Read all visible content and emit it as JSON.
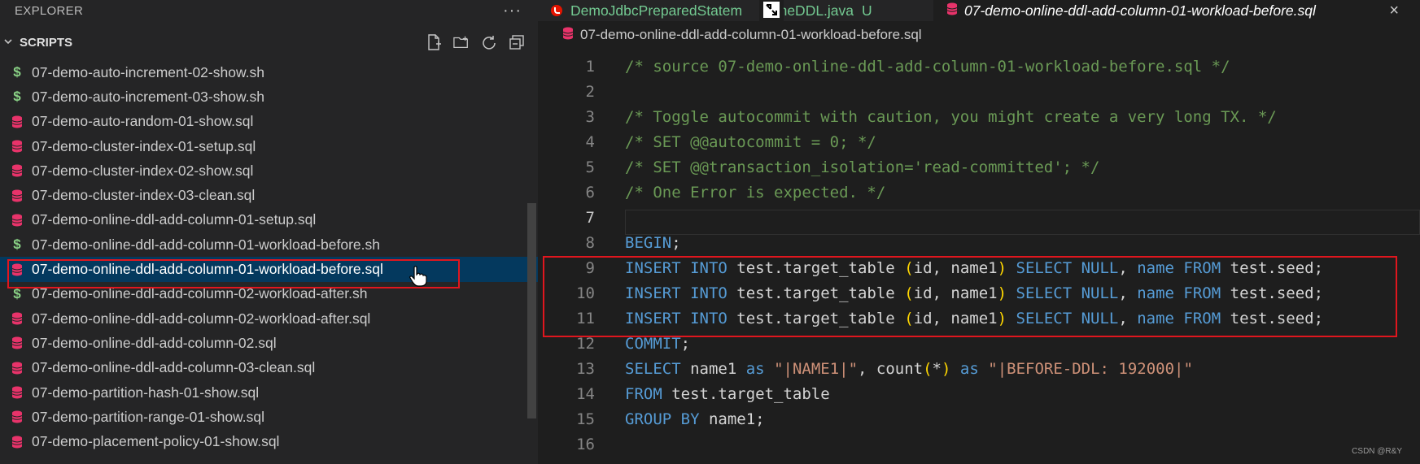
{
  "sidebar": {
    "title": "EXPLORER",
    "more_label": "···",
    "section_title": "SCRIPTS",
    "files": [
      {
        "name": "07-demo-auto-increment-02-show.sh",
        "type": "sh"
      },
      {
        "name": "07-demo-auto-increment-03-show.sh",
        "type": "sh"
      },
      {
        "name": "07-demo-auto-random-01-show.sql",
        "type": "sql"
      },
      {
        "name": "07-demo-cluster-index-01-setup.sql",
        "type": "sql"
      },
      {
        "name": "07-demo-cluster-index-02-show.sql",
        "type": "sql"
      },
      {
        "name": "07-demo-cluster-index-03-clean.sql",
        "type": "sql"
      },
      {
        "name": "07-demo-online-ddl-add-column-01-setup.sql",
        "type": "sql"
      },
      {
        "name": "07-demo-online-ddl-add-column-01-workload-before.sh",
        "type": "sh"
      },
      {
        "name": "07-demo-online-ddl-add-column-01-workload-before.sql",
        "type": "sql",
        "selected": true
      },
      {
        "name": "07-demo-online-ddl-add-column-02-workload-after.sh",
        "type": "sh"
      },
      {
        "name": "07-demo-online-ddl-add-column-02-workload-after.sql",
        "type": "sql"
      },
      {
        "name": "07-demo-online-ddl-add-column-02.sql",
        "type": "sql"
      },
      {
        "name": "07-demo-online-ddl-add-column-03-clean.sql",
        "type": "sql"
      },
      {
        "name": "07-demo-partition-hash-01-show.sql",
        "type": "sql"
      },
      {
        "name": "07-demo-partition-range-01-show.sql",
        "type": "sql"
      },
      {
        "name": "07-demo-placement-policy-01-show.sql",
        "type": "sql"
      }
    ]
  },
  "tabs": {
    "tab1_left": "DemoJdbcPreparedStatem",
    "tab1_right": "nlineDDL.java",
    "tab1_status": "U",
    "tab2_label": "07-demo-online-ddl-add-column-01-workload-before.sql",
    "tab2_close": "×"
  },
  "breadcrumb": "07-demo-online-ddl-add-column-01-workload-before.sql",
  "editor": {
    "active_line": 7,
    "lines": [
      {
        "n": "1",
        "tokens": [
          [
            "cm",
            "/* source 07-demo-online-ddl-add-column-01-workload-before.sql */"
          ]
        ]
      },
      {
        "n": "2",
        "tokens": []
      },
      {
        "n": "3",
        "tokens": [
          [
            "cm",
            "/* Toggle autocommit with caution, you might create a very long TX. */"
          ]
        ]
      },
      {
        "n": "4",
        "tokens": [
          [
            "cm",
            "/* SET @@autocommit = 0; */"
          ]
        ]
      },
      {
        "n": "5",
        "tokens": [
          [
            "cm",
            "/* SET @@transaction_isolation='read-committed'; */"
          ]
        ]
      },
      {
        "n": "6",
        "tokens": [
          [
            "cm",
            "/* One Error is expected. */"
          ]
        ]
      },
      {
        "n": "7",
        "tokens": []
      },
      {
        "n": "8",
        "tokens": [
          [
            "kw",
            "BEGIN"
          ],
          [
            "id",
            ";"
          ]
        ]
      },
      {
        "n": "9",
        "tokens": [
          [
            "kw",
            "INSERT INTO"
          ],
          [
            "id",
            " test.target_table "
          ],
          [
            "pn",
            "("
          ],
          [
            "id",
            "id, name1"
          ],
          [
            "pn",
            ")"
          ],
          [
            "id",
            " "
          ],
          [
            "kw",
            "SELECT NULL"
          ],
          [
            "id",
            ", "
          ],
          [
            "kw",
            "name FROM"
          ],
          [
            "id",
            " test.seed;"
          ]
        ]
      },
      {
        "n": "10",
        "tokens": [
          [
            "kw",
            "INSERT INTO"
          ],
          [
            "id",
            " test.target_table "
          ],
          [
            "pn",
            "("
          ],
          [
            "id",
            "id, name1"
          ],
          [
            "pn",
            ")"
          ],
          [
            "id",
            " "
          ],
          [
            "kw",
            "SELECT NULL"
          ],
          [
            "id",
            ", "
          ],
          [
            "kw",
            "name FROM"
          ],
          [
            "id",
            " test.seed;"
          ]
        ]
      },
      {
        "n": "11",
        "tokens": [
          [
            "kw",
            "INSERT INTO"
          ],
          [
            "id",
            " test.target_table "
          ],
          [
            "pn",
            "("
          ],
          [
            "id",
            "id, name1"
          ],
          [
            "pn",
            ")"
          ],
          [
            "id",
            " "
          ],
          [
            "kw",
            "SELECT NULL"
          ],
          [
            "id",
            ", "
          ],
          [
            "kw",
            "name FROM"
          ],
          [
            "id",
            " test.seed;"
          ]
        ]
      },
      {
        "n": "12",
        "tokens": [
          [
            "kw",
            "COMMIT"
          ],
          [
            "id",
            ";"
          ]
        ]
      },
      {
        "n": "13",
        "tokens": [
          [
            "kw",
            "SELECT"
          ],
          [
            "id",
            " name1 "
          ],
          [
            "kw",
            "as"
          ],
          [
            "id",
            " "
          ],
          [
            "st",
            "\"|NAME1|\""
          ],
          [
            "id",
            ", count"
          ],
          [
            "pn",
            "("
          ],
          [
            "id",
            "*"
          ],
          [
            "pn",
            ")"
          ],
          [
            "id",
            " "
          ],
          [
            "kw",
            "as"
          ],
          [
            "id",
            " "
          ],
          [
            "st",
            "\"|BEFORE-DDL: 192000|\""
          ]
        ]
      },
      {
        "n": "14",
        "tokens": [
          [
            "kw",
            "FROM"
          ],
          [
            "id",
            " test.target_table"
          ]
        ]
      },
      {
        "n": "15",
        "tokens": [
          [
            "kw",
            "GROUP BY"
          ],
          [
            "id",
            " name1;"
          ]
        ]
      },
      {
        "n": "16",
        "tokens": []
      }
    ]
  },
  "watermark": "CSDN @R&Y",
  "colors": {
    "highlight": "#e0161e",
    "selection": "#04395e",
    "comment": "#6a9955",
    "keyword": "#569cd6"
  }
}
